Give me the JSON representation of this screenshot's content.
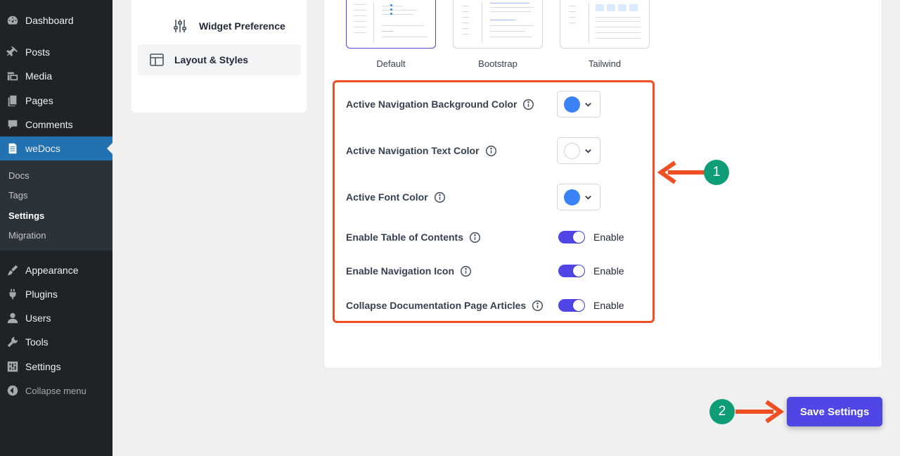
{
  "admin_menu": {
    "items": [
      {
        "label": "Dashboard",
        "icon": "dashboard-icon"
      },
      {
        "label": "Posts",
        "icon": "pin-icon"
      },
      {
        "label": "Media",
        "icon": "media-icon"
      },
      {
        "label": "Pages",
        "icon": "pages-icon"
      },
      {
        "label": "Comments",
        "icon": "comment-icon"
      },
      {
        "label": "weDocs",
        "icon": "document-icon"
      },
      {
        "label": "Appearance",
        "icon": "brush-icon"
      },
      {
        "label": "Plugins",
        "icon": "plug-icon"
      },
      {
        "label": "Users",
        "icon": "user-icon"
      },
      {
        "label": "Tools",
        "icon": "wrench-icon"
      },
      {
        "label": "Settings",
        "icon": "sliders-icon"
      },
      {
        "label": "Collapse menu",
        "icon": "collapse-arrow-icon"
      }
    ],
    "submenu": [
      "Docs",
      "Tags",
      "Settings",
      "Migration"
    ]
  },
  "settings_nav": {
    "widget_preference": "Widget Preference",
    "layout_styles": "Layout & Styles"
  },
  "templates": [
    "Default",
    "Bootstrap",
    "Tailwind"
  ],
  "fields": {
    "nav_bg_color": {
      "label": "Active Navigation Background Color",
      "color": "#3b82f6"
    },
    "nav_text_color": {
      "label": "Active Navigation Text Color",
      "color": "#ffffff"
    },
    "font_color": {
      "label": "Active Font Color",
      "color": "#3b82f6"
    },
    "toc": {
      "label": "Enable Table of Contents",
      "state": "Enable"
    },
    "nav_icon": {
      "label": "Enable Navigation Icon",
      "state": "Enable"
    },
    "collapse_articles": {
      "label": "Collapse Documentation Page Articles",
      "state": "Enable"
    }
  },
  "annotations": {
    "badge_1": "1",
    "badge_2": "2"
  },
  "save_button": "Save Settings",
  "colors": {
    "accent": "#4f46e5",
    "wp_blue": "#2271b1",
    "highlight": "#f04e23",
    "badge": "#0f9d78"
  }
}
